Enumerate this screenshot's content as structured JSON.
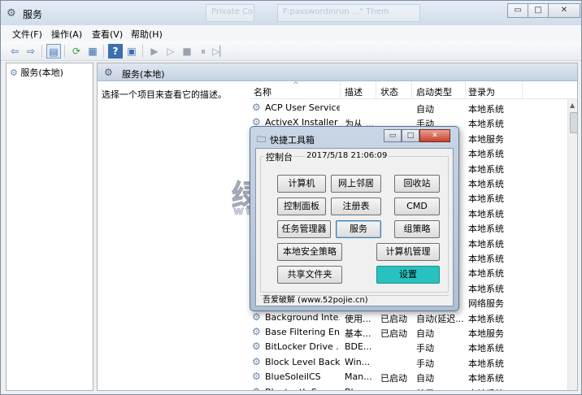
{
  "window": {
    "title": "服务",
    "icon": "gear-search-icon",
    "min": "▭",
    "max": "□",
    "close": "✕"
  },
  "ghost_tabs": [
    "Private Co",
    "F:passwordinrun ...\" Them"
  ],
  "menu": [
    "文件(F)",
    "操作(A)",
    "查看(V)",
    "帮助(H)"
  ],
  "toolbar_icons": [
    "back-icon",
    "forward-icon",
    "show-hide-tree-icon",
    "refresh-icon",
    "export-icon",
    "help-icon",
    "properties-icon",
    "play-icon",
    "play-alt-icon",
    "stop-icon",
    "pause-icon",
    "restart-icon"
  ],
  "tree": {
    "root": "服务(本地)"
  },
  "right_header": "服务(本地)",
  "description_hint": "选择一个项目来查看它的描述。",
  "columns": [
    "名称",
    "描述",
    "状态",
    "启动类型",
    "登录为"
  ],
  "services": [
    [
      "ACP User Service",
      "",
      "",
      "自动",
      "本地系统"
    ],
    [
      "ActiveX Installer ...",
      "为从 ...",
      "",
      "手动",
      "本地系统"
    ],
    [
      "",
      "",
      "",
      "",
      "本地服务"
    ],
    [
      "",
      "",
      "",
      "",
      "本地系统"
    ],
    [
      "",
      "",
      "",
      "",
      "本地系统"
    ],
    [
      "",
      "",
      "",
      "",
      "本地系统"
    ],
    [
      "",
      "",
      "",
      "",
      "本地系统"
    ],
    [
      "",
      "",
      "",
      "",
      "本地系统"
    ],
    [
      "",
      "",
      "",
      "",
      "本地系统"
    ],
    [
      "",
      "",
      "",
      "",
      "本地系统"
    ],
    [
      "",
      "",
      "",
      "",
      "本地系统"
    ],
    [
      "",
      "",
      "",
      "",
      "本地系统"
    ],
    [
      "",
      "",
      "",
      "",
      "本地系统"
    ],
    [
      "",
      "",
      "",
      "",
      "网络服务"
    ],
    [
      "Background Inte...",
      "使用...",
      "已启动",
      "自动(延迟...",
      "本地系统"
    ],
    [
      "Base Filtering En...",
      "基本...",
      "已启动",
      "自动",
      "本地服务"
    ],
    [
      "BitLocker Drive ...",
      "BDE...",
      "",
      "手动",
      "本地系统"
    ],
    [
      "Block Level Back...",
      "Win...",
      "",
      "手动",
      "本地系统"
    ],
    [
      "BlueSoleilCS",
      "Man...",
      "已启动",
      "自动",
      "本地系统"
    ],
    [
      "Bluetooth Supp...",
      "Blue...",
      "",
      "禁用",
      "本地系统"
    ]
  ],
  "watermark": {
    "big": "绿色资源",
    "url": "www.greenxf.com"
  },
  "popup": {
    "title": "快捷工具箱",
    "min": "▭",
    "max": "□",
    "close": "✕",
    "group_label": "控制台",
    "datetime": "2017/5/18  21:06:09",
    "buttons": {
      "computer": "计算机",
      "network": "网上邻居",
      "recycle": "回收站",
      "control_panel": "控制面板",
      "registry": "注册表",
      "cmd": "CMD",
      "task_manager": "任务管理器",
      "services": "服务",
      "group_policy": "组策略",
      "local_security": "本地安全策略",
      "computer_mgmt": "计算机管理",
      "shared_folders": "共享文件夹",
      "settings": "设置"
    },
    "status": "吾爱破解 (www.52pojie.cn)"
  },
  "colors": {
    "accent_teal": "#27c1c0",
    "title_gradient_top": "#e6eef8"
  }
}
